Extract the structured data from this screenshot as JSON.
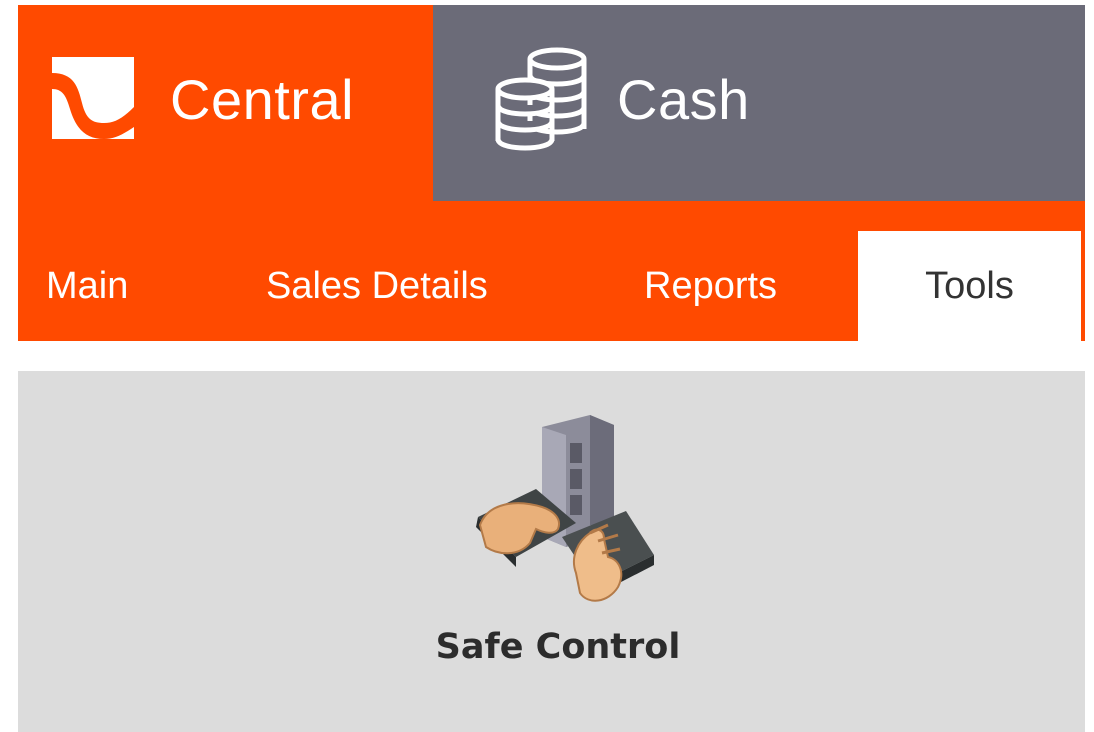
{
  "header": {
    "brand_title": "Central",
    "brand_icon": "central-logo-icon",
    "module_title": "Cash",
    "module_icon": "coins-stack-icon",
    "colors": {
      "brand": "#ff4a00",
      "module": "#6b6b78"
    }
  },
  "nav": {
    "tabs": [
      {
        "label": "Main"
      },
      {
        "label": "Sales Details"
      },
      {
        "label": "Reports"
      },
      {
        "label": "Tools",
        "selected": true
      }
    ]
  },
  "tools": {
    "items": [
      {
        "label": "Safe Control",
        "icon": "safe-control-icon"
      }
    ]
  }
}
